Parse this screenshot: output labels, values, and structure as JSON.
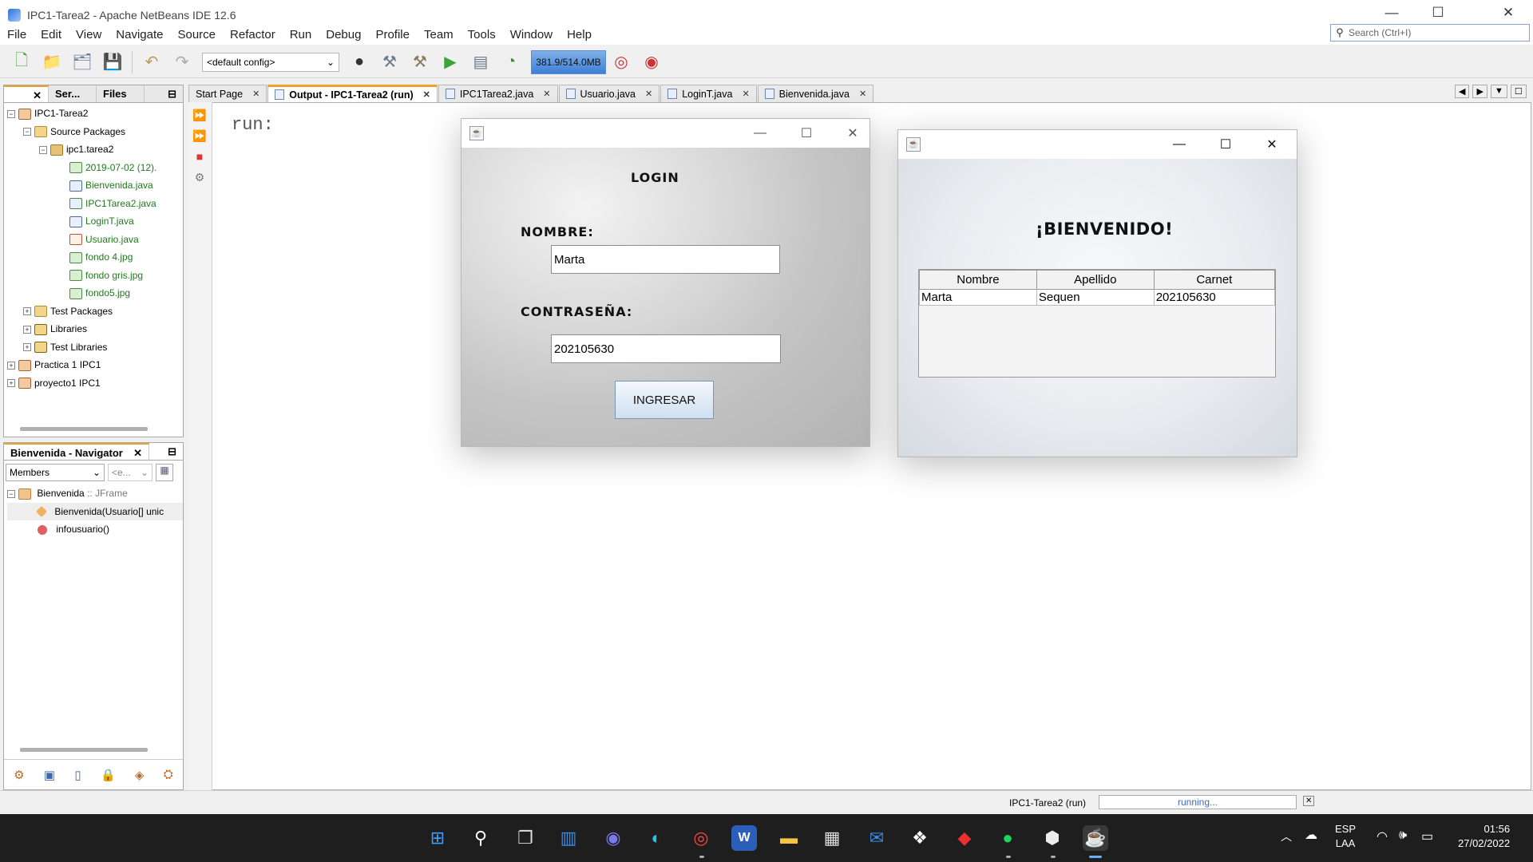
{
  "window": {
    "title": "IPC1-Tarea2 - Apache NetBeans IDE 12.6"
  },
  "menu": [
    "File",
    "Edit",
    "View",
    "Navigate",
    "Source",
    "Refactor",
    "Run",
    "Debug",
    "Profile",
    "Team",
    "Tools",
    "Window",
    "Help"
  ],
  "search": {
    "placeholder": "Search (Ctrl+I)"
  },
  "toolbar": {
    "config": "<default config>",
    "memory": "381.9/514.0MB"
  },
  "projects": {
    "tabs": [
      "Ser...",
      "Files"
    ],
    "tree": [
      {
        "label": "IPC1-Tarea2",
        "level": 0,
        "icon": "project-icon",
        "exp": "−"
      },
      {
        "label": "Source Packages",
        "level": 1,
        "icon": "package-folder-icon",
        "exp": "−"
      },
      {
        "label": "ipc1.tarea2",
        "level": 2,
        "icon": "package-icon",
        "exp": "−"
      },
      {
        "label": "2019-07-02 (12).",
        "level": 3,
        "icon": "image-file-icon",
        "green": true
      },
      {
        "label": "Bienvenida.java",
        "level": 3,
        "icon": "java-form-icon",
        "green": true
      },
      {
        "label": "IPC1Tarea2.java",
        "level": 3,
        "icon": "java-main-icon",
        "green": true
      },
      {
        "label": "LoginT.java",
        "level": 3,
        "icon": "java-form-icon",
        "green": true
      },
      {
        "label": "Usuario.java",
        "level": 3,
        "icon": "java-class-icon",
        "green": true
      },
      {
        "label": "fondo 4.jpg",
        "level": 3,
        "icon": "image-file-icon",
        "green": true
      },
      {
        "label": "fondo gris.jpg",
        "level": 3,
        "icon": "image-file-icon",
        "green": true
      },
      {
        "label": "fondo5.jpg",
        "level": 3,
        "icon": "image-file-icon",
        "green": true
      },
      {
        "label": "Test Packages",
        "level": 1,
        "icon": "package-folder-icon",
        "exp": "+"
      },
      {
        "label": "Libraries",
        "level": 1,
        "icon": "library-icon",
        "exp": "+"
      },
      {
        "label": "Test Libraries",
        "level": 1,
        "icon": "library-icon",
        "exp": "+"
      },
      {
        "label": "Practica 1 IPC1",
        "level": 0,
        "icon": "project-icon",
        "exp": "+"
      },
      {
        "label": "proyecto1 IPC1",
        "level": 0,
        "icon": "project-icon",
        "exp": "+"
      }
    ]
  },
  "navigator": {
    "title": "Bienvenida - Navigator",
    "members": "Members",
    "filter": "<e...",
    "root": "Bienvenida",
    "root_type": " :: JFrame",
    "items": [
      "Bienvenida(Usuario[] unic",
      "infousuario()"
    ]
  },
  "editor": {
    "tabs": [
      {
        "label": "Start Page",
        "active": false
      },
      {
        "label": "Output - IPC1-Tarea2 (run)",
        "active": true
      },
      {
        "label": "IPC1Tarea2.java",
        "active": false
      },
      {
        "label": "Usuario.java",
        "active": false
      },
      {
        "label": "LoginT.java",
        "active": false
      },
      {
        "label": "Bienvenida.java",
        "active": false
      }
    ],
    "output": "run:"
  },
  "login": {
    "heading": "LOGIN",
    "nombre_label": "NOMBRE:",
    "nombre_value": "Marta",
    "password_label": "CONTRASEÑA:",
    "password_value": "202105630",
    "button": "INGRESAR"
  },
  "welcome": {
    "heading": "¡BIENVENIDO!",
    "columns": [
      "Nombre",
      "Apellido",
      "Carnet"
    ],
    "rows": [
      [
        "Marta",
        "Sequen",
        "202105630"
      ]
    ]
  },
  "status": {
    "process": "IPC1-Tarea2 (run)",
    "state": "running..."
  },
  "taskbar": {
    "lang": "ESP",
    "layout": "LAA",
    "time": "01:56",
    "date": "27/02/2022"
  }
}
